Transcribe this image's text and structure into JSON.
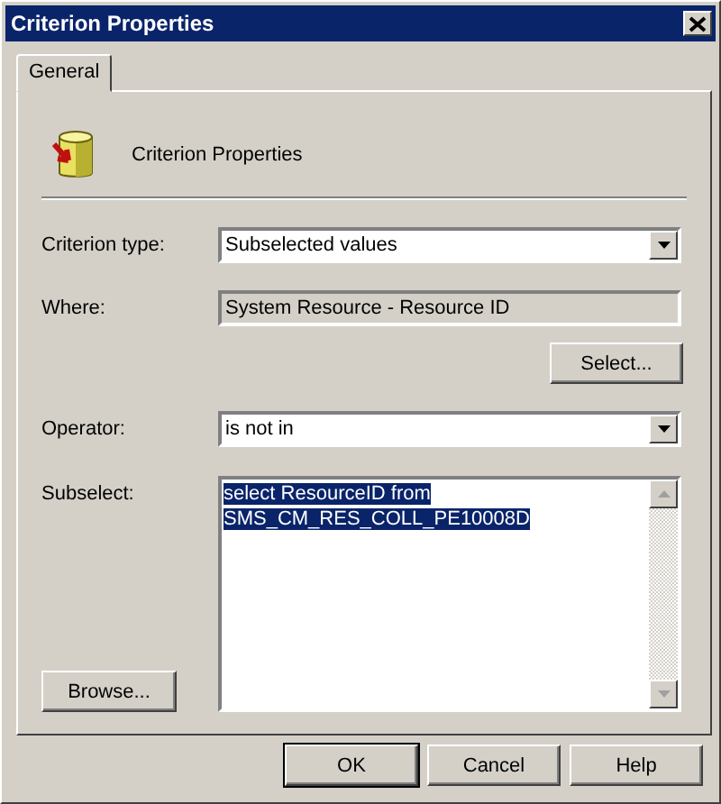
{
  "window": {
    "title": "Criterion Properties"
  },
  "tabs": [
    {
      "label": "General",
      "selected": true
    }
  ],
  "header": {
    "title": "Criterion Properties"
  },
  "criterion_type": {
    "label": "Criterion type:",
    "value": "Subselected values"
  },
  "where": {
    "label": "Where:",
    "value": "System Resource - Resource ID"
  },
  "select_button": {
    "label": "Select..."
  },
  "operator": {
    "label": "Operator:",
    "value": "is not in"
  },
  "subselect": {
    "label": "Subselect:",
    "lines": [
      "select ResourceID from",
      "SMS_CM_RES_COLL_PE10008D"
    ],
    "selected": true
  },
  "browse_button": {
    "label": "Browse..."
  },
  "buttons": [
    {
      "label": "OK",
      "default": true
    },
    {
      "label": "Cancel",
      "default": false
    },
    {
      "label": "Help",
      "default": false
    }
  ]
}
